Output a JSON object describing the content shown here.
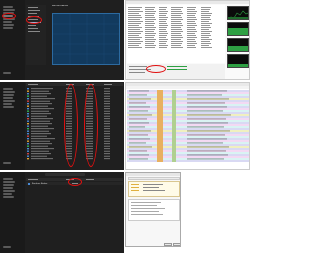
{
  "taskmanager_perf": {
    "title": "Performance",
    "panel_title": "Performance",
    "chart_title": "Ethernet/Wi-Fi",
    "sidebar_items": [
      "Processes",
      "Performance",
      "App history",
      "Startup apps",
      "Users",
      "Details",
      "Services",
      "Settings"
    ]
  },
  "taskmanager_processes": {
    "title": "Processes"
  },
  "taskmanager_small": {
    "title": "Processes",
    "row_label": "Runtime Broker"
  },
  "colors": {
    "dark_bg": "#1f1f1f",
    "chart_bg": "#123a5e",
    "accent_red": "#e01010",
    "graph_green": "#2ea043"
  }
}
